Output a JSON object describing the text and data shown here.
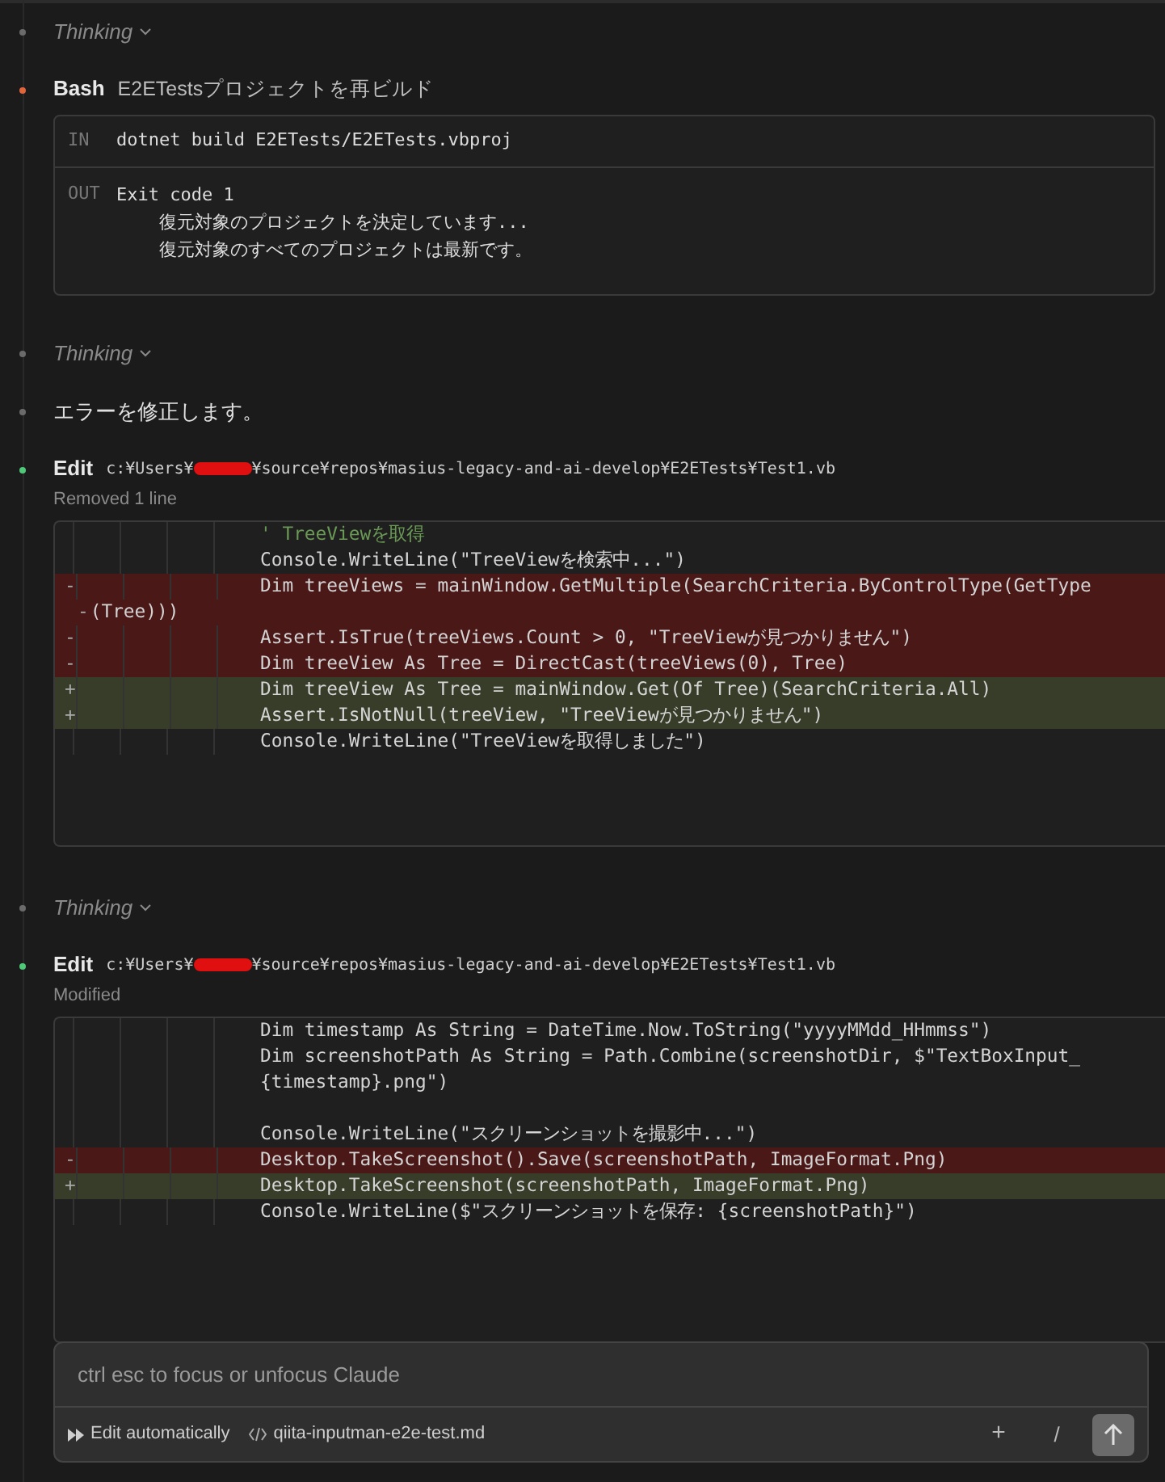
{
  "entries": [
    {
      "kind": "thinking",
      "label": "Thinking",
      "color": "#6b6b6b"
    },
    {
      "kind": "bash",
      "label": "Bash",
      "title": "E2ETestsプロジェクトを再ビルド",
      "color": "#e0643c",
      "in_label": "IN",
      "command": "dotnet build E2ETests/E2ETests.vbproj",
      "out_label": "OUT",
      "output": [
        "Exit code 1",
        "    復元対象のプロジェクトを決定しています...",
        "    復元対象のすべてのプロジェクトは最新です。"
      ]
    },
    {
      "kind": "thinking",
      "label": "Thinking",
      "color": "#6b6b6b"
    },
    {
      "kind": "message",
      "text": "エラーを修正します。",
      "color": "#6b6b6b"
    },
    {
      "kind": "edit",
      "label": "Edit",
      "path_before": "c:¥Users¥",
      "path_after": "¥source¥repos¥masius-legacy-and-ai-develop¥E2ETests¥Test1.vb",
      "summary": "Removed 1 line",
      "color": "#4ec97a",
      "rows": [
        {
          "kind": "comment",
          "text": "' TreeViewを取得"
        },
        {
          "kind": "context",
          "text": "Console.WriteLine(\"TreeViewを検索中...\")"
        },
        {
          "kind": "removed",
          "marker": "-",
          "text": "Dim treeViews = mainWindow.GetMultiple(SearchCriteria.ByControlType(GetType"
        },
        {
          "kind": "removed",
          "marker": "-",
          "continuation": true,
          "text": "(Tree)))"
        },
        {
          "kind": "removed",
          "marker": "-",
          "text": "Assert.IsTrue(treeViews.Count > 0, \"TreeViewが見つかりません\")"
        },
        {
          "kind": "removed",
          "marker": "-",
          "text": "Dim treeView As Tree = DirectCast(treeViews(0), Tree)"
        },
        {
          "kind": "added",
          "marker": "+",
          "text": "Dim treeView As Tree = mainWindow.Get(Of Tree)(SearchCriteria.All)"
        },
        {
          "kind": "added",
          "marker": "+",
          "text": "Assert.IsNotNull(treeView, \"TreeViewが見つかりません\")"
        },
        {
          "kind": "context",
          "text": "Console.WriteLine(\"TreeViewを取得しました\")"
        }
      ]
    },
    {
      "kind": "thinking",
      "label": "Thinking",
      "color": "#6b6b6b"
    },
    {
      "kind": "edit",
      "label": "Edit",
      "path_before": "c:¥Users¥",
      "path_after": "¥source¥repos¥masius-legacy-and-ai-develop¥E2ETests¥Test1.vb",
      "summary": "Modified",
      "color": "#4ec97a",
      "rows": [
        {
          "kind": "context",
          "text": "Dim timestamp As String = DateTime.Now.ToString(\"yyyyMMdd_HHmmss\")"
        },
        {
          "kind": "context",
          "text": "Dim screenshotPath As String = Path.Combine(screenshotDir, $\"TextBoxInput_"
        },
        {
          "kind": "context",
          "text": "{timestamp}.png\")"
        },
        {
          "kind": "context"
        },
        {
          "kind": "context",
          "text": "Console.WriteLine(\"スクリーンショットを撮影中...\")"
        },
        {
          "kind": "removed",
          "marker": "-",
          "text": "Desktop.TakeScreenshot().Save(screenshotPath, ImageFormat.Png)"
        },
        {
          "kind": "added",
          "marker": "+",
          "text": "Desktop.TakeScreenshot(screenshotPath, ImageFormat.Png)"
        },
        {
          "kind": "context",
          "text": "Console.WriteLine($\"スクリーンショットを保存: {screenshotPath}\")"
        }
      ]
    }
  ],
  "composer": {
    "placeholder": "ctrl esc to focus or unfocus Claude",
    "mode": "Edit automatically",
    "file": "qiita-inputman-e2e-test.md",
    "plus": "+",
    "slash": "/"
  }
}
